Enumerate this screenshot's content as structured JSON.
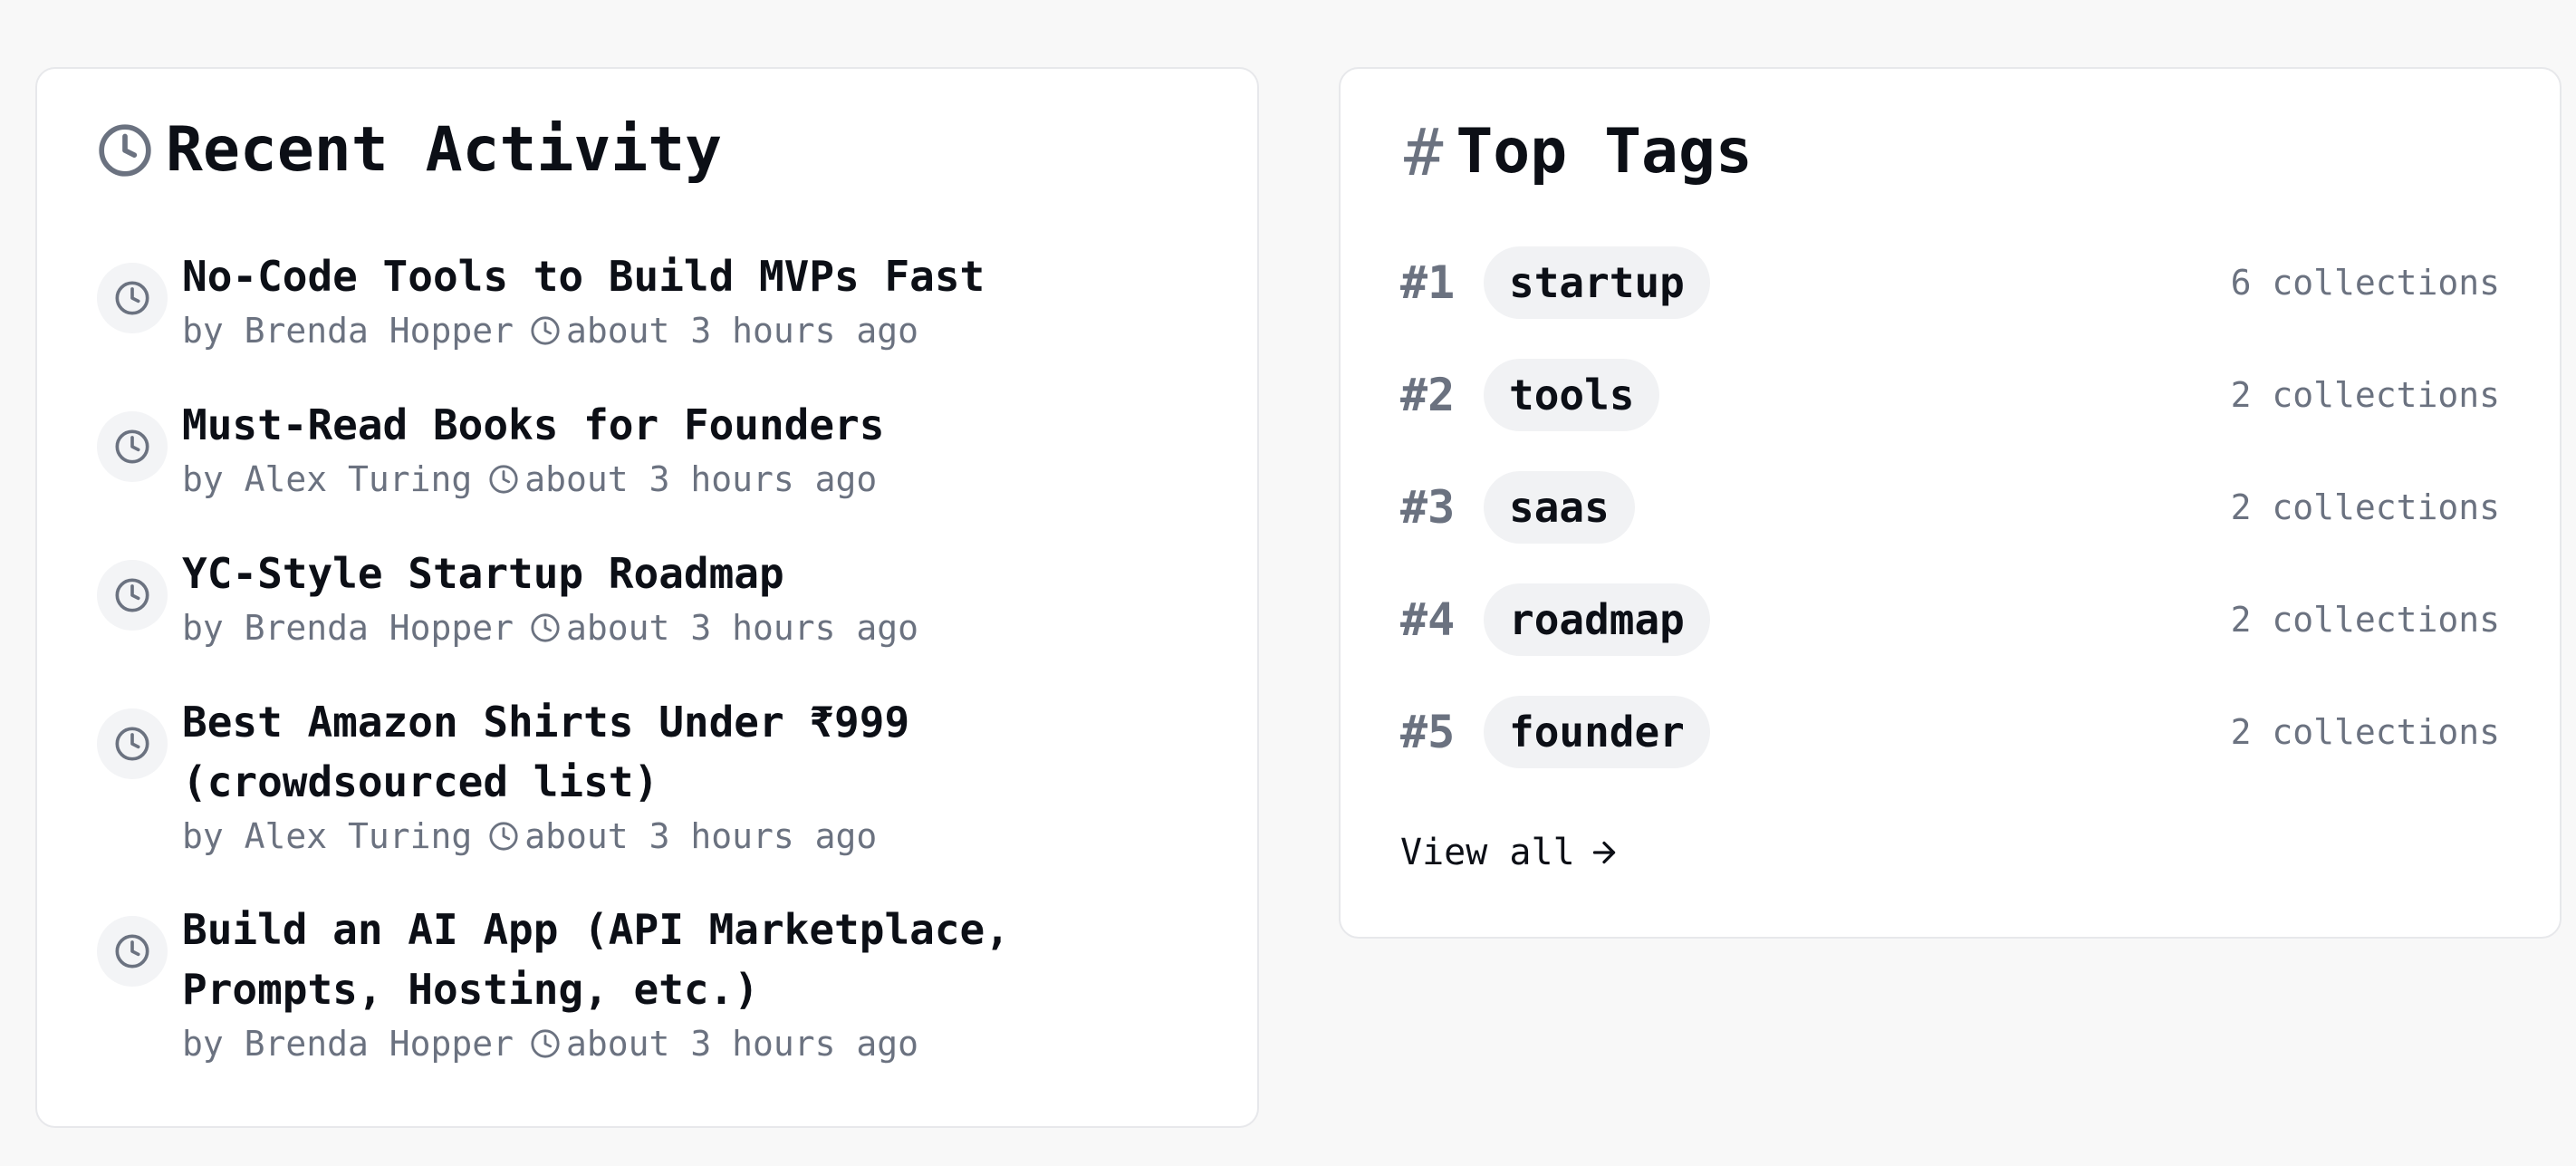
{
  "recent_activity": {
    "title": "Recent Activity",
    "items": [
      {
        "title": "No-Code Tools to Build MVPs Fast",
        "author": "by Brenda Hopper",
        "time": "about 3 hours ago"
      },
      {
        "title": "Must-Read Books for Founders",
        "author": "by Alex Turing",
        "time": "about 3 hours ago"
      },
      {
        "title": "YC-Style Startup Roadmap",
        "author": "by Brenda Hopper",
        "time": "about 3 hours ago"
      },
      {
        "title": "Best Amazon Shirts Under ₹999 (crowdsourced list)",
        "author": "by Alex Turing",
        "time": "about 3 hours ago"
      },
      {
        "title": "Build an AI App (API Marketplace, Prompts, Hosting, etc.)",
        "author": "by Brenda Hopper",
        "time": "about 3 hours ago"
      }
    ]
  },
  "top_tags": {
    "title": "Top Tags",
    "title_glyph": "#",
    "tags": [
      {
        "rank": "#1",
        "name": "startup",
        "count": "6 collections"
      },
      {
        "rank": "#2",
        "name": "tools",
        "count": "2 collections"
      },
      {
        "rank": "#3",
        "name": "saas",
        "count": "2 collections"
      },
      {
        "rank": "#4",
        "name": "roadmap",
        "count": "2 collections"
      },
      {
        "rank": "#5",
        "name": "founder",
        "count": "2 collections"
      }
    ],
    "view_all_label": "View all"
  },
  "icons": {
    "title_icon": "clock-icon",
    "item_icon": "clock-icon",
    "meta_icon": "clock-icon",
    "view_all_icon": "arrow-right-icon"
  },
  "colors": {
    "background": "#f8f8f8",
    "card": "#ffffff",
    "text": "#0c0f16",
    "muted": "#6b7280",
    "pill": "#f1f2f4"
  }
}
